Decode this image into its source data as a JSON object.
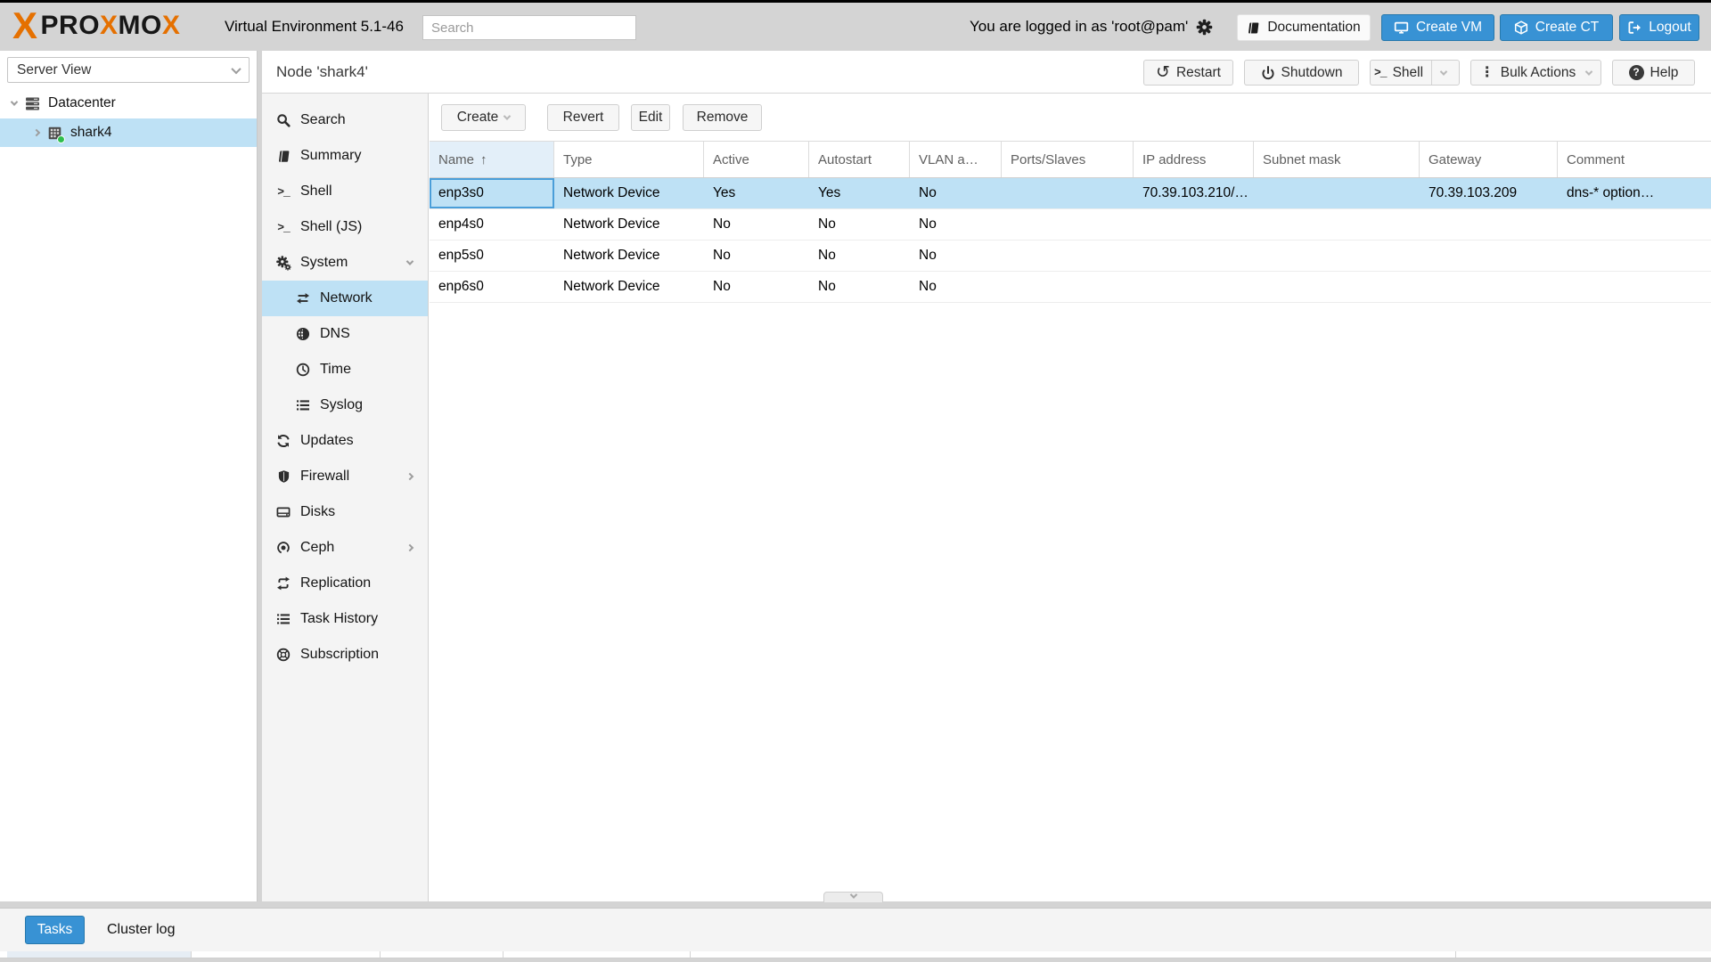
{
  "header": {
    "brand": {
      "mark": "X",
      "part1": "PRO",
      "part2": "X",
      "part3": "MO",
      "part4": "X"
    },
    "product": "Virtual Environment 5.1-46",
    "search_placeholder": "Search",
    "login_status": "You are logged in as 'root@pam'",
    "buttons": {
      "documentation": "Documentation",
      "create_vm": "Create VM",
      "create_ct": "Create CT",
      "logout": "Logout"
    }
  },
  "resource_tree": {
    "view_selector": "Server View",
    "items": [
      {
        "label": "Datacenter",
        "icon": "server-stack",
        "expanded": true
      },
      {
        "label": "shark4",
        "icon": "node",
        "selected": true,
        "status_color": "#2fbe4e"
      }
    ]
  },
  "node_panel": {
    "title": "Node 'shark4'",
    "actions": {
      "restart": "Restart",
      "shutdown": "Shutdown",
      "shell": "Shell",
      "bulk_actions": "Bulk Actions",
      "help": "Help"
    }
  },
  "menu": {
    "items": [
      {
        "label": "Search",
        "icon": "search"
      },
      {
        "label": "Summary",
        "icon": "book"
      },
      {
        "label": "Shell",
        "icon": "terminal"
      },
      {
        "label": "Shell (JS)",
        "icon": "terminal"
      },
      {
        "label": "System",
        "icon": "gears",
        "expanded": true
      },
      {
        "label": "Network",
        "icon": "swap-arrows",
        "indented": true,
        "selected": true
      },
      {
        "label": "DNS",
        "icon": "globe",
        "indented": true
      },
      {
        "label": "Time",
        "icon": "clock",
        "indented": true
      },
      {
        "label": "Syslog",
        "icon": "list",
        "indented": true
      },
      {
        "label": "Updates",
        "icon": "refresh"
      },
      {
        "label": "Firewall",
        "icon": "shield",
        "collapsible": true
      },
      {
        "label": "Disks",
        "icon": "disk"
      },
      {
        "label": "Ceph",
        "icon": "ceph",
        "collapsible": true
      },
      {
        "label": "Replication",
        "icon": "replicate"
      },
      {
        "label": "Task History",
        "icon": "list"
      },
      {
        "label": "Subscription",
        "icon": "lifebuoy"
      }
    ]
  },
  "toolbar": {
    "create": "Create",
    "revert": "Revert",
    "edit": "Edit",
    "remove": "Remove"
  },
  "network_table": {
    "columns": [
      "Name",
      "Type",
      "Active",
      "Autostart",
      "VLAN a…",
      "Ports/Slaves",
      "IP address",
      "Subnet mask",
      "Gateway",
      "Comment"
    ],
    "sort": {
      "column": "Name",
      "direction": "asc",
      "arrow": "↑"
    },
    "rows": [
      {
        "name": "enp3s0",
        "type": "Network Device",
        "active": "Yes",
        "autostart": "Yes",
        "vlan": "No",
        "ports": "",
        "ip": "70.39.103.210/…",
        "subnet": "",
        "gateway": "70.39.103.209",
        "comment": "dns-* option…",
        "selected": true
      },
      {
        "name": "enp4s0",
        "type": "Network Device",
        "active": "No",
        "autostart": "No",
        "vlan": "No",
        "ports": "",
        "ip": "",
        "subnet": "",
        "gateway": "",
        "comment": ""
      },
      {
        "name": "enp5s0",
        "type": "Network Device",
        "active": "No",
        "autostart": "No",
        "vlan": "No",
        "ports": "",
        "ip": "",
        "subnet": "",
        "gateway": "",
        "comment": ""
      },
      {
        "name": "enp6s0",
        "type": "Network Device",
        "active": "No",
        "autostart": "No",
        "vlan": "No",
        "ports": "",
        "ip": "",
        "subnet": "",
        "gateway": "",
        "comment": ""
      }
    ]
  },
  "bottom_bar": {
    "tasks": "Tasks",
    "cluster_log": "Cluster log"
  },
  "colors": {
    "accent_blue": "#3892d4",
    "selection_blue": "#bee1f5",
    "header_gray": "#d4d4d4",
    "proxmox_orange": "#e57000",
    "node_status_green": "#2fbe4e"
  }
}
